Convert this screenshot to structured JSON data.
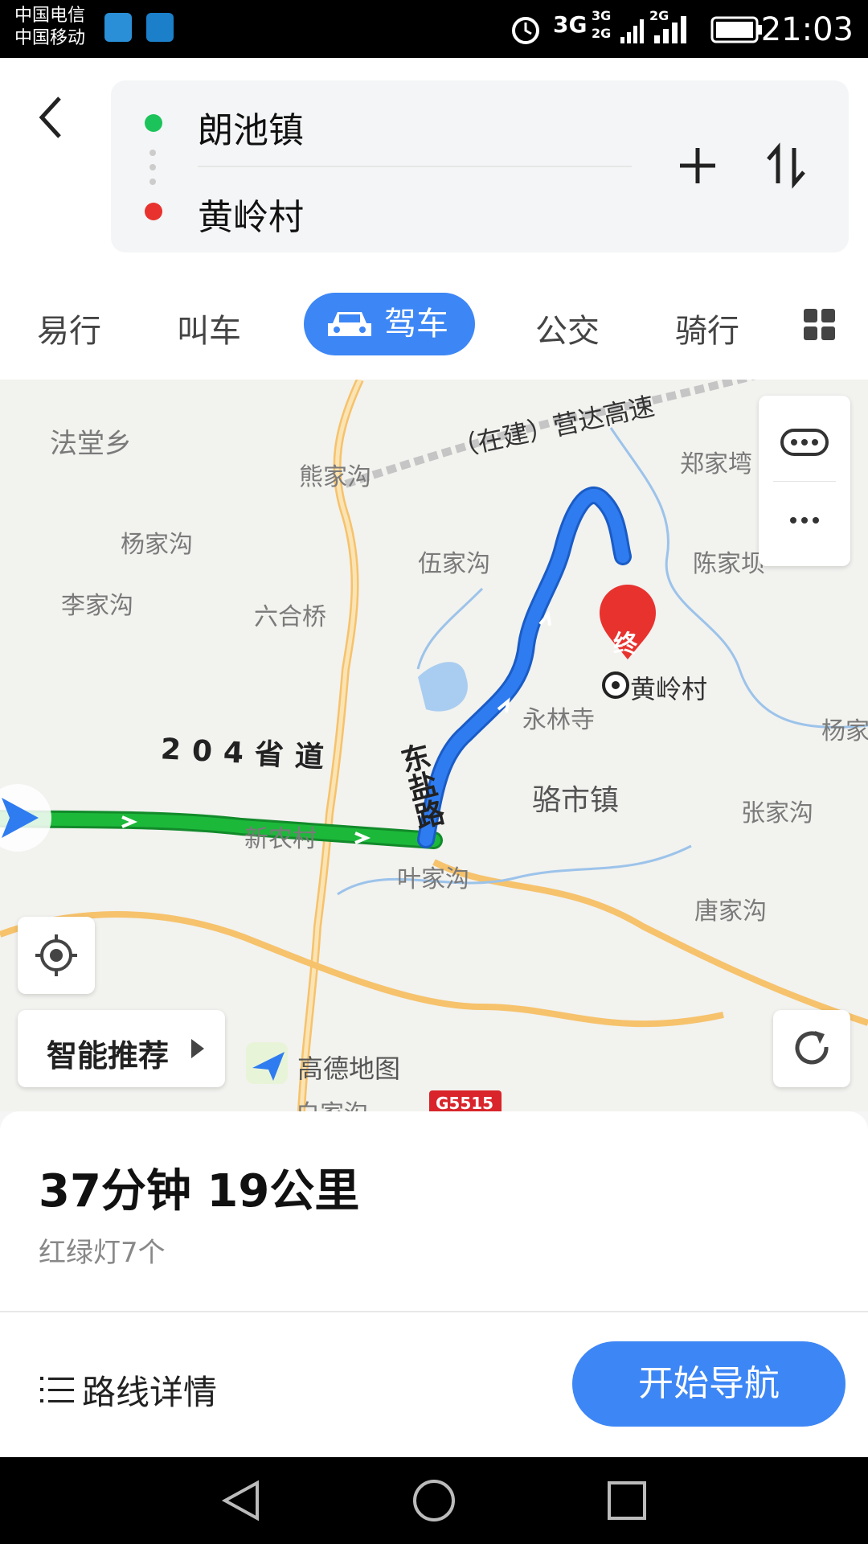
{
  "status_bar": {
    "carrier_1": "中国电信",
    "carrier_2": "中国移动",
    "network_1": "3G",
    "network_2": "3G",
    "network_3": "2G",
    "network_4": "2G",
    "clock": "21:03",
    "icons": [
      "map-app-icon",
      "health-app-icon",
      "alarm-icon",
      "signal-icon",
      "battery-icon"
    ]
  },
  "route": {
    "origin": "朗池镇",
    "destination": "黄岭村",
    "origin_color": "#1cc35a",
    "destination_color": "#e8322e"
  },
  "tabs": [
    {
      "label": "易行"
    },
    {
      "label": "叫车"
    },
    {
      "label": "驾车",
      "active": true
    },
    {
      "label": "公交"
    },
    {
      "label": "骑行"
    }
  ],
  "map": {
    "labels": [
      "法堂乡",
      "熊家沟",
      "郑家塆",
      "杨家沟",
      "伍家沟",
      "陈家坝",
      "李家沟",
      "六合桥",
      "永林寺",
      "杨家",
      "骆市镇",
      "张家沟",
      "新农村",
      "叶家沟",
      "唐家沟",
      "白家沟"
    ],
    "road_under_construction": "（在建）营达高速",
    "road_main": "204省道",
    "road_secondary": "东盐路",
    "destination_pin": "终",
    "destination_label": "黄岭村",
    "highway_shield": "G5515",
    "watermark": "高德地图",
    "smart_recommend": "智能推荐",
    "route_color_green": "#1cb83a",
    "route_color_blue": "#2f7cf0"
  },
  "summary": {
    "time_distance": "37分钟  19公里",
    "traffic_lights": "红绿灯7个"
  },
  "footer": {
    "detail_label": "路线详情",
    "start_nav_label": "开始导航",
    "accent": "#3d86f5"
  }
}
